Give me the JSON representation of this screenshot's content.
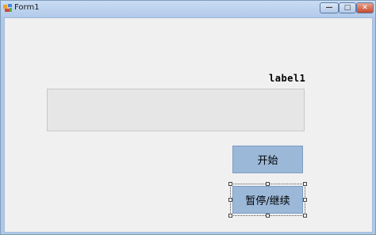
{
  "window": {
    "title": "Form1",
    "minimize_glyph": "—",
    "maximize_glyph": "□",
    "close_glyph": "✕"
  },
  "form": {
    "label1_text": "label1",
    "textbox_value": "",
    "start_button_label": "开始",
    "pause_button_label": "暂停/继续"
  }
}
